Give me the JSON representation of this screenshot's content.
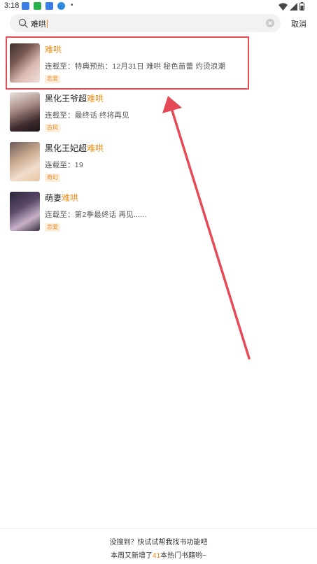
{
  "status_bar": {
    "time": "3:18",
    "dot": "•",
    "app_icons": [
      "app-icon-1",
      "app-icon-2",
      "app-icon-3",
      "download-icon"
    ],
    "indicators": [
      "wifi-icon",
      "signal-icon",
      "battery-icon"
    ]
  },
  "search": {
    "query": "难哄",
    "cancel_label": "取消"
  },
  "results": [
    {
      "title_prefix": "",
      "title_match": "难哄",
      "update_text": "连载至：特典预热：12月31日 难哄 秘色苗蕾 灼烫浪潮",
      "tag": "恋爱"
    },
    {
      "title_prefix": "黑化王爷超",
      "title_match": "难哄",
      "update_text": "连载至：最终话 终将再见",
      "tag": "古风"
    },
    {
      "title_prefix": "黑化王妃超",
      "title_match": "难哄",
      "update_text": "连载至：19",
      "tag": "奇幻"
    },
    {
      "title_prefix": "萌妻",
      "title_match": "难哄",
      "update_text": "连载至：第2季最终话 再见......",
      "tag": "恋爱"
    }
  ],
  "footer": {
    "line1": "没搜到？快试试帮我找书功能吧",
    "line2_prefix": "本周又新增了",
    "line2_count": "41",
    "line2_suffix": "本热门书籍哟~"
  },
  "colors": {
    "accent": "#f08f1a",
    "annotation": "#e64a57"
  }
}
